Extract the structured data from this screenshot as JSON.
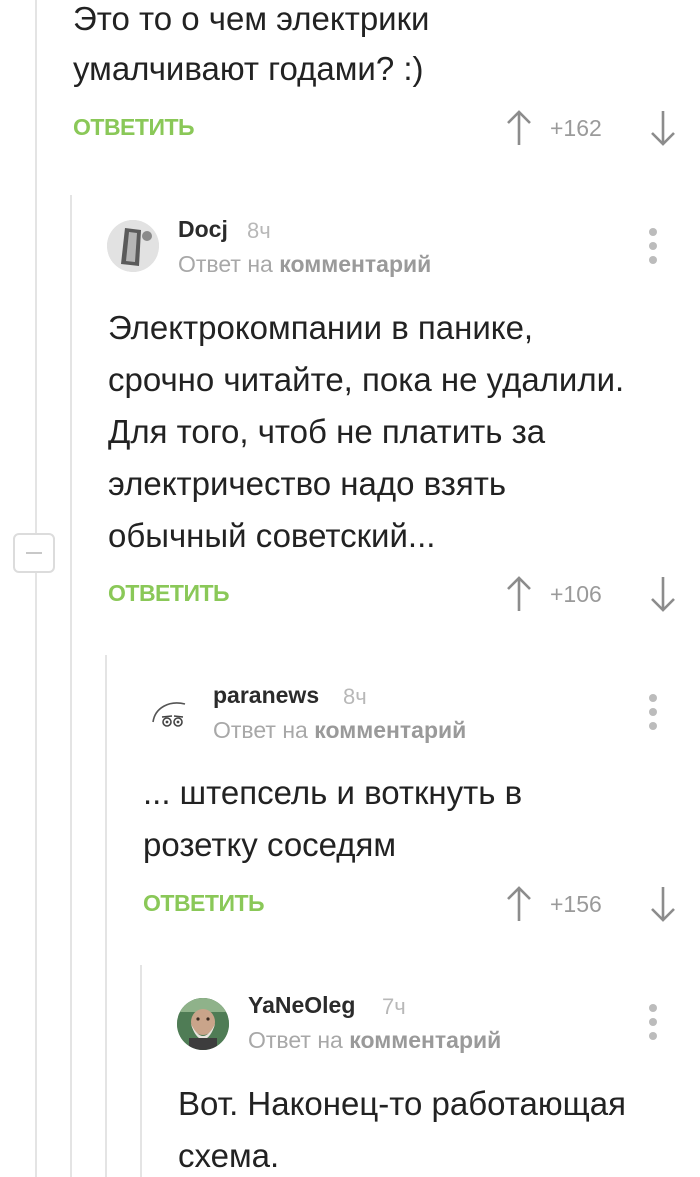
{
  "colors": {
    "accent_green": "#8ac858",
    "thread_line": "#e4e4e4",
    "muted_text": "#9a9a9a"
  },
  "icons": {
    "vote_up": "arrow-up-icon",
    "vote_down": "arrow-down-icon",
    "more": "more-vertical-icon",
    "collapse": "minus-icon"
  },
  "comment0": {
    "text_lines": [
      "Это то о чем электрики",
      "умалчивают годами? :)"
    ],
    "reply_label": "ОТВЕТИТЬ",
    "rating": "+162"
  },
  "comment1": {
    "author": "Docj",
    "time": "8ч",
    "reply_prefix": "Ответ на",
    "reply_link": "комментарий",
    "text_lines": [
      "Электрокомпании в панике,",
      "срочно читайте, пока не удалили.",
      "Для того, чтоб не платить за",
      "электричество надо взять",
      "обычный советский..."
    ],
    "reply_label": "ОТВЕТИТЬ",
    "rating": "+106"
  },
  "comment2": {
    "author": "paranews",
    "time": "8ч",
    "reply_prefix": "Ответ на",
    "reply_link": "комментарий",
    "text_lines": [
      "... штепсель и воткнуть в",
      "розетку соседям"
    ],
    "reply_label": "ОТВЕТИТЬ",
    "rating": "+156"
  },
  "comment3": {
    "author": "YaNeOleg",
    "time": "7ч",
    "reply_prefix": "Ответ на",
    "reply_link": "комментарий",
    "text_lines": [
      "Вот. Наконец-то работающая",
      "схема."
    ]
  }
}
